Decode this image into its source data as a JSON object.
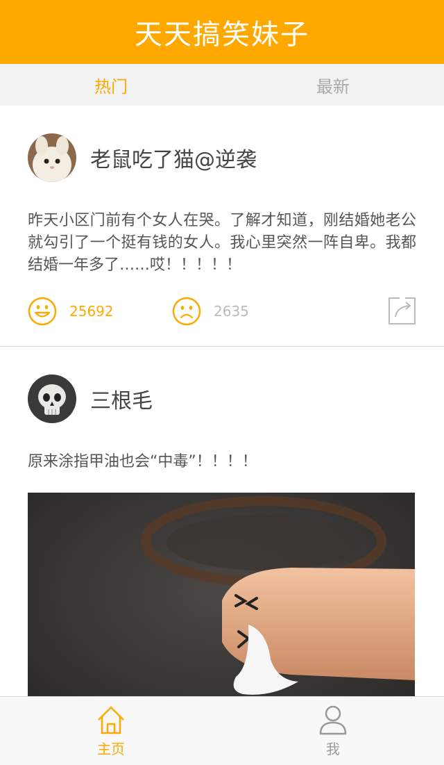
{
  "app": {
    "title": "天天搞笑妹子"
  },
  "tabs": [
    {
      "label": "热门",
      "active": true
    },
    {
      "label": "最新",
      "active": false
    }
  ],
  "posts": [
    {
      "username": "老鼠吃了猫@逆袭",
      "avatar_icon": "rabbit-avatar",
      "text": "昨天小区门前有个女人在哭。了解才知道，刚结婚她老公就勾引了一个挺有钱的女人。我心里突然一阵自卑。我都结婚一年多了……哎！！！！！",
      "likes": "25692",
      "dislikes": "2635"
    },
    {
      "username": "三根毛",
      "avatar_icon": "skull-avatar",
      "text": "原来涂指甲油也会“中毒”！！！！"
    }
  ],
  "bottom_nav": [
    {
      "label": "主页",
      "icon": "home-icon",
      "active": true
    },
    {
      "label": "我",
      "icon": "user-icon",
      "active": false
    }
  ],
  "colors": {
    "accent": "#ffa800",
    "muted": "#bbbbbb",
    "tab_bg": "#f2f2f2"
  }
}
